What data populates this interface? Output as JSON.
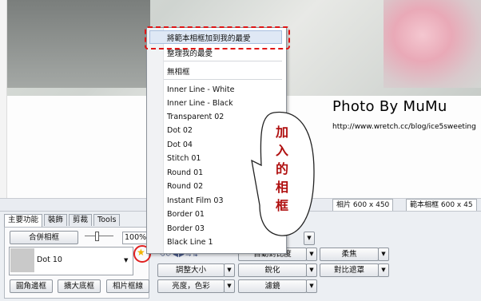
{
  "photo": {
    "title": "Photo  By  MuMu",
    "url": "http://www.wretch.cc/blog/ice5sweeting"
  },
  "size_tabs": [
    "相片 600 x 450",
    "範本相框 600 x 45"
  ],
  "tabs": [
    {
      "label": "主要功能",
      "active": true
    },
    {
      "label": "裝飾",
      "active": false
    },
    {
      "label": "剪裁",
      "active": false
    },
    {
      "label": "Tools",
      "active": false
    }
  ],
  "main_panel": {
    "merge_frame_button": "合併相框",
    "zoom_percent": "100%",
    "selected_frame": "Dot 10",
    "round_border_button": "圓角邊框",
    "expand_border_button": "擴大底框",
    "photo_frame_line_button": "相片框線"
  },
  "right_buttons": {
    "auto_contrast": "自動對比度",
    "soft_focus": "柔焦",
    "resize": "調整大小",
    "sharpen": "銳化",
    "contrast_mask": "對比遮罩",
    "brightness_color": "亮度，色彩",
    "filter": "濾鏡"
  },
  "menu": {
    "favorites_top": [
      "將範本相框加到我的最愛",
      "整理我的最愛"
    ],
    "no_frame": "無相框",
    "items": [
      "Inner Line - White",
      "Inner Line - Black",
      "Transparent 02",
      "Dot 02",
      "Dot 04",
      "Stitch 01",
      "Round 01",
      "Round 02",
      "Instant Film 03",
      "Border 01",
      "Border 03",
      "Black Line 1"
    ]
  },
  "annotation": {
    "bubble_chars": [
      "加",
      "入",
      "的",
      "相",
      "框"
    ],
    "highlight_color": "#e01515"
  },
  "icons": {
    "favorite": "star-icon",
    "dropdown": "chevron-down-icon"
  }
}
